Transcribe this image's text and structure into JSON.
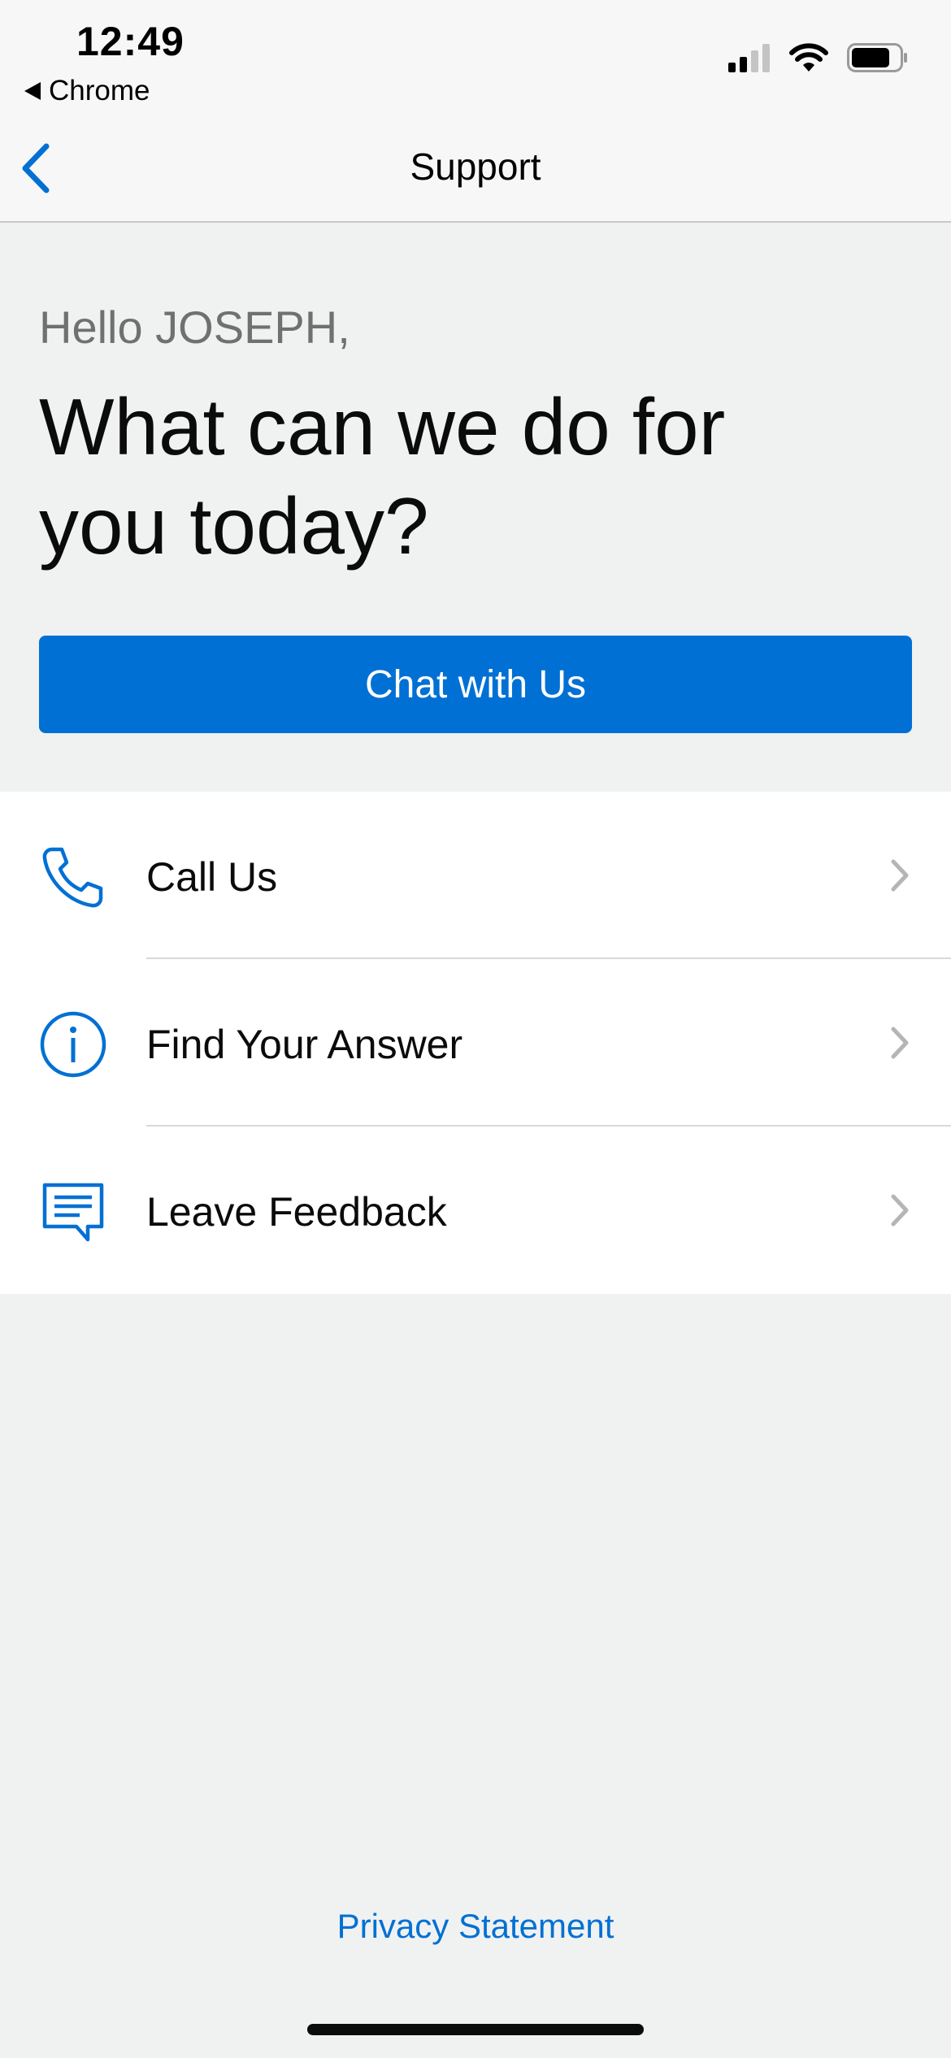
{
  "status_bar": {
    "time": "12:49",
    "back_app_label": "Chrome"
  },
  "nav": {
    "title": "Support"
  },
  "main": {
    "greeting": "Hello JOSEPH,",
    "headline": "What can we do for you today?",
    "chat_button_label": "Chat with Us"
  },
  "list": {
    "items": [
      {
        "label": "Call Us",
        "icon": "phone-icon"
      },
      {
        "label": "Find Your Answer",
        "icon": "info-icon"
      },
      {
        "label": "Leave Feedback",
        "icon": "feedback-icon"
      }
    ]
  },
  "footer": {
    "privacy_label": "Privacy Statement"
  },
  "colors": {
    "accent": "#0170d4",
    "background": "#f0f1f1"
  }
}
